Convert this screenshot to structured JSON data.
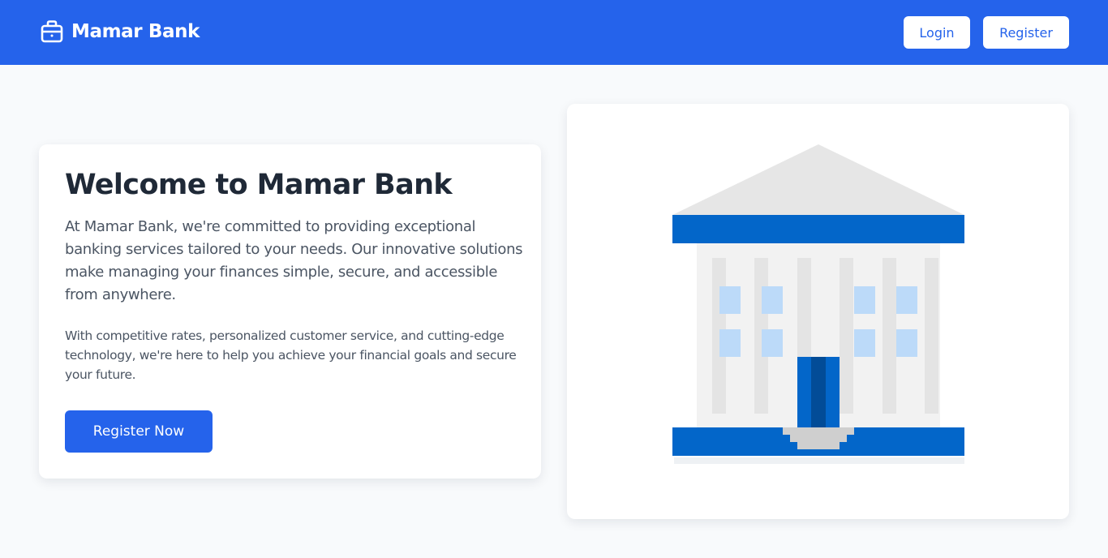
{
  "header": {
    "brand_name": "Mamar Bank",
    "brand_icon": "briefcase-icon",
    "login_label": "Login",
    "register_label": "Register"
  },
  "hero": {
    "title": "Welcome to Mamar Bank",
    "lead": "At Mamar Bank, we're committed to providing exceptional banking services tailored to your needs. Our innovative solutions make managing your finances simple, secure, and accessible from anywhere.",
    "sub": "With competitive rates, personalized customer service, and cutting-edge technology, we're here to help you achieve your financial goals and secure your future.",
    "cta_label": "Register Now"
  },
  "illustration": {
    "name": "bank-building-illustration",
    "colors": {
      "brand_blue": "#2563eb",
      "bank_blue": "#0366c9",
      "roof_gray": "#e6e6e6",
      "window_blue": "#bcdaf9"
    }
  }
}
